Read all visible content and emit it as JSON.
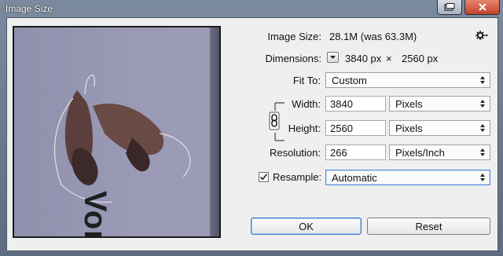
{
  "window": {
    "title": "Image Size"
  },
  "preview": {
    "visible_text": "Vor"
  },
  "info": {
    "image_size_label": "Image Size:",
    "image_size_value": "28.1M (was 63.3M)",
    "dimensions_label": "Dimensions:",
    "dimensions_width": "3840 px",
    "dimensions_sep": "×",
    "dimensions_height": "2560 px"
  },
  "fit_to": {
    "label": "Fit To:",
    "value": "Custom"
  },
  "width": {
    "label": "Width:",
    "value": "3840",
    "unit": "Pixels"
  },
  "height": {
    "label": "Height:",
    "value": "2560",
    "unit": "Pixels"
  },
  "resolution": {
    "label": "Resolution:",
    "value": "266",
    "unit": "Pixels/Inch"
  },
  "resample": {
    "checked": true,
    "label": "Resample:",
    "value": "Automatic"
  },
  "buttons": {
    "ok": "OK",
    "reset": "Reset"
  },
  "icons": {
    "gear": "gear-icon",
    "chain": "chain-link-icon",
    "close": "close-icon",
    "restore": "restore-icon"
  },
  "colors": {
    "title_bar": "#6f7f95",
    "dialog_bg": "#efefef",
    "focus": "#5a8bd6"
  }
}
